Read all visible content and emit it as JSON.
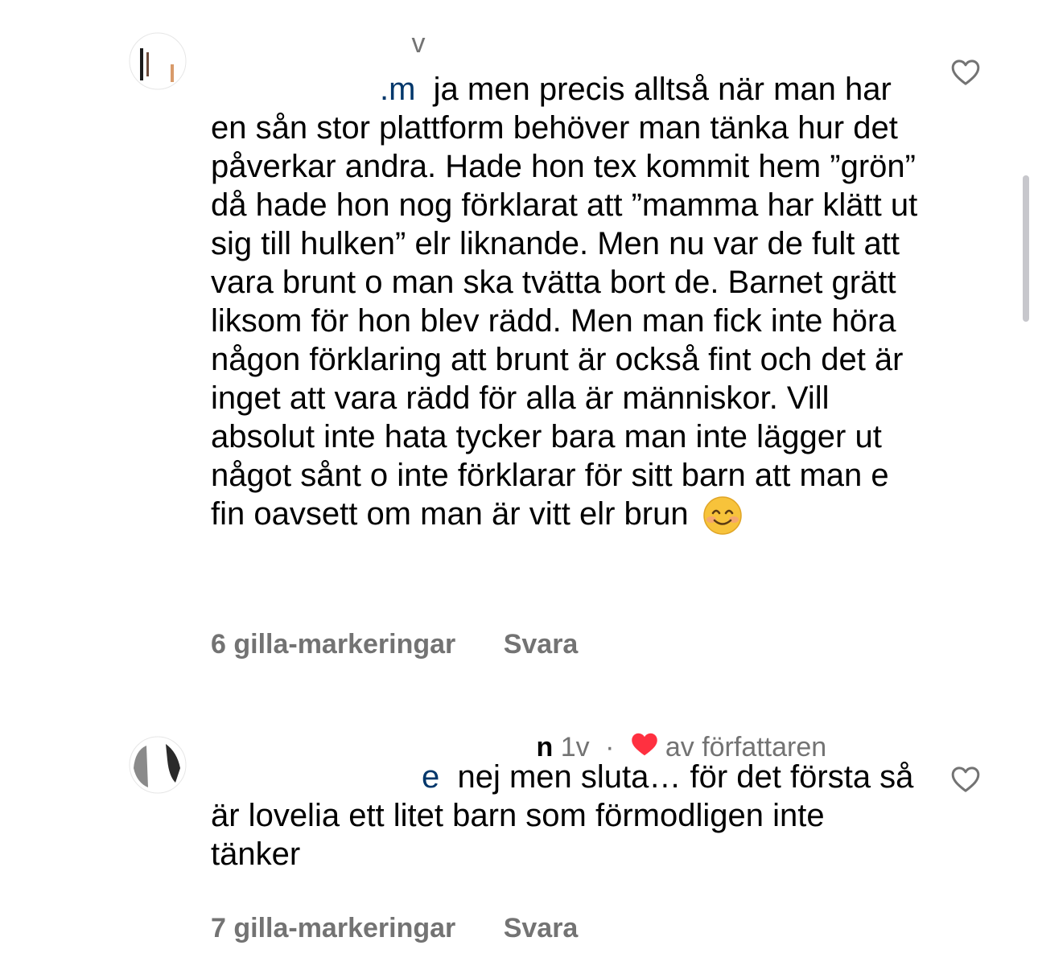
{
  "comments": [
    {
      "username": "",
      "time": "v",
      "mention": ".m",
      "text": "ja men precis alltså när man har en sån stor plattform behöver man tänka hur det påverkar andra. Hade hon tex kommit hem ”grön” då hade hon nog förklarat att ”mamma har klätt ut sig till hulken” elr liknande. Men nu var de fult att vara brunt o man ska tvätta bort de. Barnet grätt liksom för hon blev rädd. Men man fick inte höra någon förklaring att brunt är också fint och det är inget att vara rädd för alla är människor. Vill absolut inte hata tycker bara man inte lägger ut något sånt o inte förklarar för sitt barn att man e fin oavsett om man är vitt elr brun",
      "emoji": "smiling-face-with-smiling-eyes",
      "likes": "6 gilla-markeringar",
      "reply": "Svara"
    },
    {
      "username": "n",
      "time": "1v",
      "dot": "·",
      "liked_by_author": "av författaren",
      "mention": "e",
      "text": "nej men sluta… för det första så är lovelia ett litet barn som förmodligen inte tänker",
      "likes": "7 gilla-markeringar",
      "reply": "Svara"
    }
  ],
  "icons": {
    "like": "heart-outline-icon",
    "author_like": "heart-filled-icon"
  },
  "colors": {
    "text": "#000000",
    "secondary": "#737373",
    "mention": "#00376b",
    "heart_red": "#ff3040",
    "scrollbar": "#c7c7cc"
  }
}
